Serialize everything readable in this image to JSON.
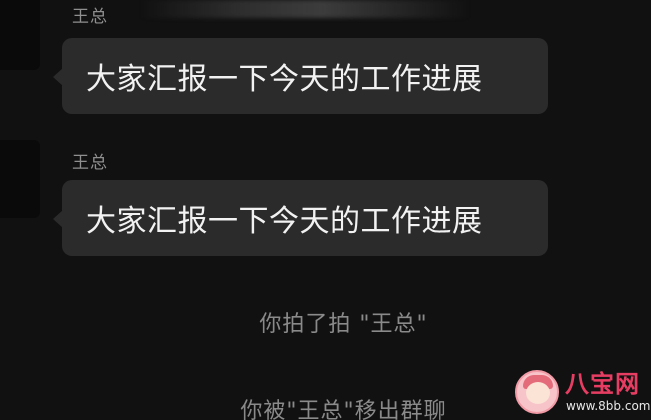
{
  "chat": {
    "messages": [
      {
        "sender": "王总",
        "text": "大家汇报一下今天的工作进展"
      },
      {
        "sender": "王总",
        "text": "大家汇报一下今天的工作进展"
      }
    ],
    "system_messages": {
      "pat": "你拍了拍 \"王总\"",
      "removed": "你被\"王总\"移出群聊"
    }
  },
  "watermark": {
    "title": "八宝网",
    "url": "www.8bb.com"
  },
  "colors": {
    "background": "#111111",
    "bubble": "#2b2b2b",
    "bubble_text": "#f2f2f2",
    "sender_text": "#8f8f8f",
    "system_text": "#8a8a8a",
    "watermark_accent": "#e83d63"
  },
  "icons": {
    "avatar": "avatar",
    "watermark_logo": "cartoon-girl-logo"
  }
}
